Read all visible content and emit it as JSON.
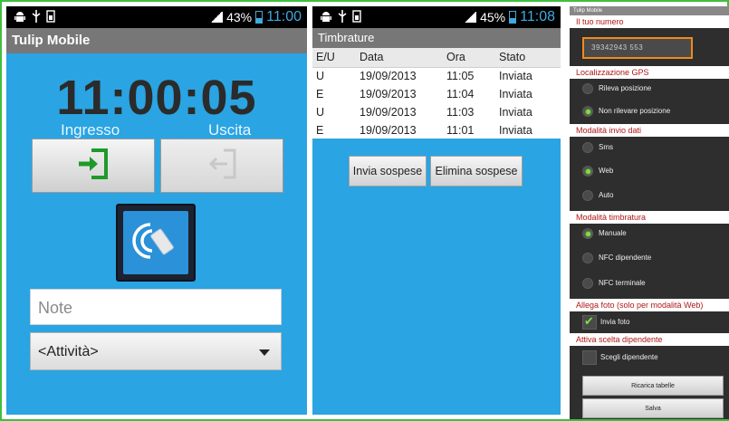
{
  "phone1": {
    "status": {
      "battery": "43%",
      "time": "11:00"
    },
    "app_title": "Tulip Mobile",
    "clock": "11:00:05",
    "ingresso_label": "Ingresso",
    "uscita_label": "Uscita",
    "note_placeholder": "Note",
    "activity_selected": "<Attività>"
  },
  "phone2": {
    "status": {
      "battery": "45%",
      "time": "11:08"
    },
    "title": "Timbrature",
    "columns": [
      "E/U",
      "Data",
      "Ora",
      "Stato"
    ],
    "rows": [
      [
        "U",
        "19/09/2013",
        "11:05",
        "Inviata"
      ],
      [
        "E",
        "19/09/2013",
        "11:04",
        "Inviata"
      ],
      [
        "U",
        "19/09/2013",
        "11:03",
        "Inviata"
      ],
      [
        "E",
        "19/09/2013",
        "11:01",
        "Inviata"
      ]
    ],
    "send_button": "Invia sospese",
    "delete_button": "Elimina sospese"
  },
  "phone3": {
    "title": "Tulip Mobile",
    "number_label": "Il tuo numero",
    "number_value": "39342943 553",
    "gps_label": "Localizzazione GPS",
    "gps_options": [
      {
        "label": "Rileva posizione",
        "selected": false
      },
      {
        "label": "Non rilevare posizione",
        "selected": true
      }
    ],
    "send_mode_label": "Modalità invio dati",
    "send_mode_options": [
      {
        "label": "Sms",
        "selected": false
      },
      {
        "label": "Web",
        "selected": true
      },
      {
        "label": "Auto",
        "selected": false
      }
    ],
    "stamp_mode_label": "Modalità timbratura",
    "stamp_mode_options": [
      {
        "label": "Manuale",
        "selected": true
      },
      {
        "label": "NFC dipendente",
        "selected": false
      },
      {
        "label": "NFC terminale",
        "selected": false
      }
    ],
    "photo_label": "Allega foto (solo per modalità Web)",
    "photo_checkbox": {
      "label": "Invia foto",
      "checked": true
    },
    "employee_label": "Attiva scelta dipendente",
    "employee_checkbox": {
      "label": "Scegli dipendente",
      "checked": false
    },
    "reload_button": "Ricarica tabelle",
    "save_button": "Salva"
  },
  "colors": {
    "accent_blue": "#2aa4e2",
    "frame_green": "#3fbf3f",
    "section_red": "#b01616",
    "focus_orange": "#f08a1c",
    "radio_green": "#7fe03f"
  }
}
